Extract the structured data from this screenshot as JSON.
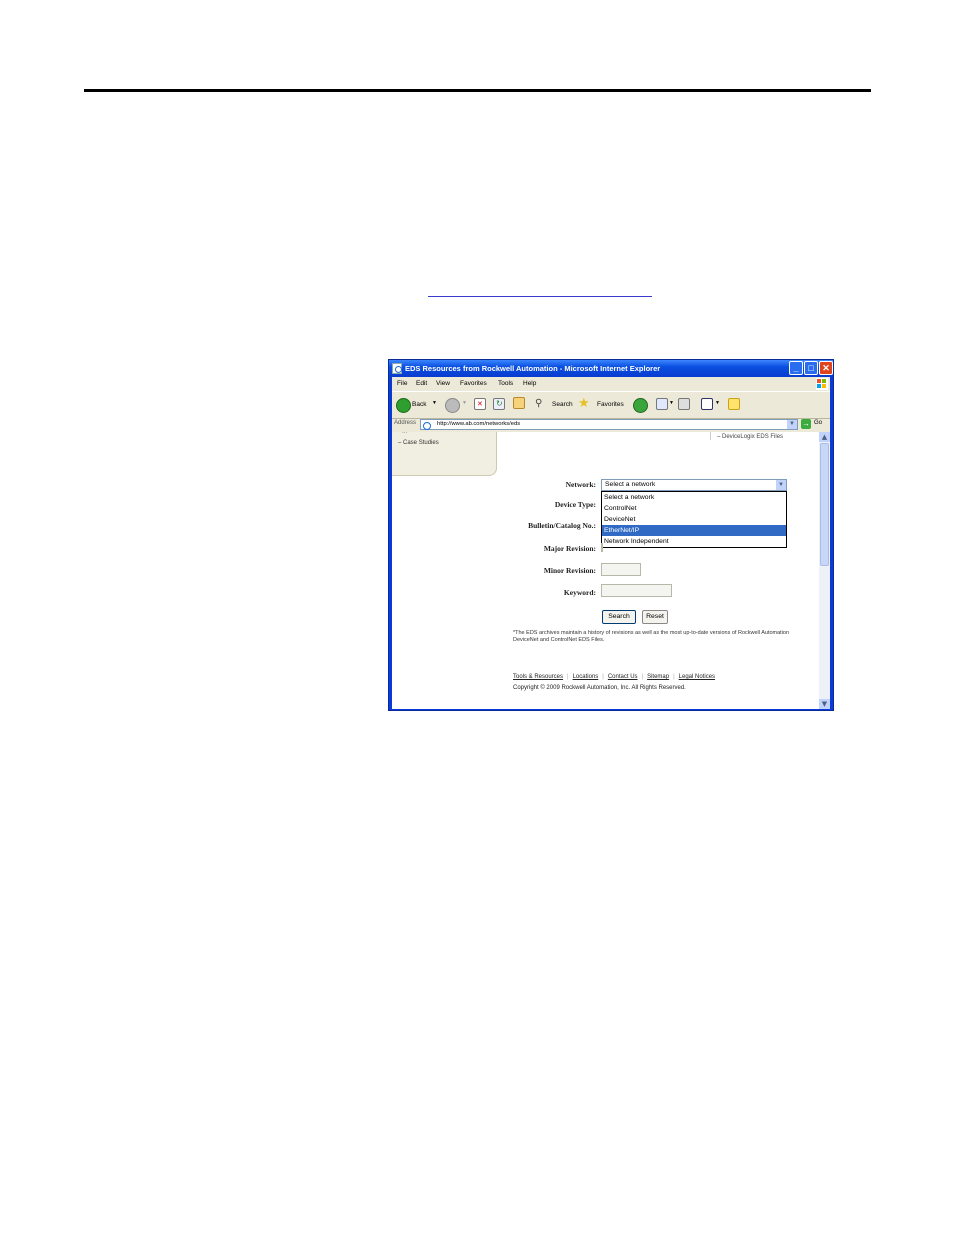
{
  "window": {
    "title": "EDS Resources from Rockwell Automation - Microsoft Internet Explorer",
    "minimize_glyph": "_",
    "maximize_glyph": "□",
    "close_glyph": "✕"
  },
  "menu": {
    "items": [
      "File",
      "Edit",
      "View",
      "Favorites",
      "Tools",
      "Help"
    ]
  },
  "toolbar": {
    "back_label": "Back",
    "search_label": "Search",
    "favorites_label": "Favorites"
  },
  "address": {
    "label": "Address",
    "url": "http://www.ab.com/networks/eds",
    "go_label": "Go"
  },
  "sidebar": {
    "cut_text": "...",
    "item": "Case Studies"
  },
  "right_link": "DeviceLogix EDS Files",
  "form": {
    "network_label": "Network:",
    "device_type_label": "Device Type:",
    "bulletin_label": "Bulletin/Catalog No.:",
    "major_label": "Major Revision:",
    "minor_label": "Minor Revision:",
    "keyword_label": "Keyword:",
    "network_selected": "Select a network",
    "network_options": [
      "Select a network",
      "ControlNet",
      "DeviceNet",
      "EtherNet/IP",
      "Network Independent"
    ],
    "highlighted_option": "EtherNet/IP",
    "search_button": "Search",
    "reset_button": "Reset"
  },
  "note": "*The EDS archives maintain a history of revisions as well as the most up-to-date versions of Rockwell Automation DeviceNet and ControlNet EDS Files.",
  "footer": {
    "links": [
      "Tools & Resources",
      "Locations",
      "Contact Us",
      "Sitemap",
      "Legal Notices"
    ],
    "copyright": "Copyright © 2009 Rockwell Automation, Inc.  All Rights Reserved."
  },
  "colors": {
    "titlebar": "#0a4fe0",
    "selection": "#316ac5",
    "frame": "#0a3bd6"
  }
}
